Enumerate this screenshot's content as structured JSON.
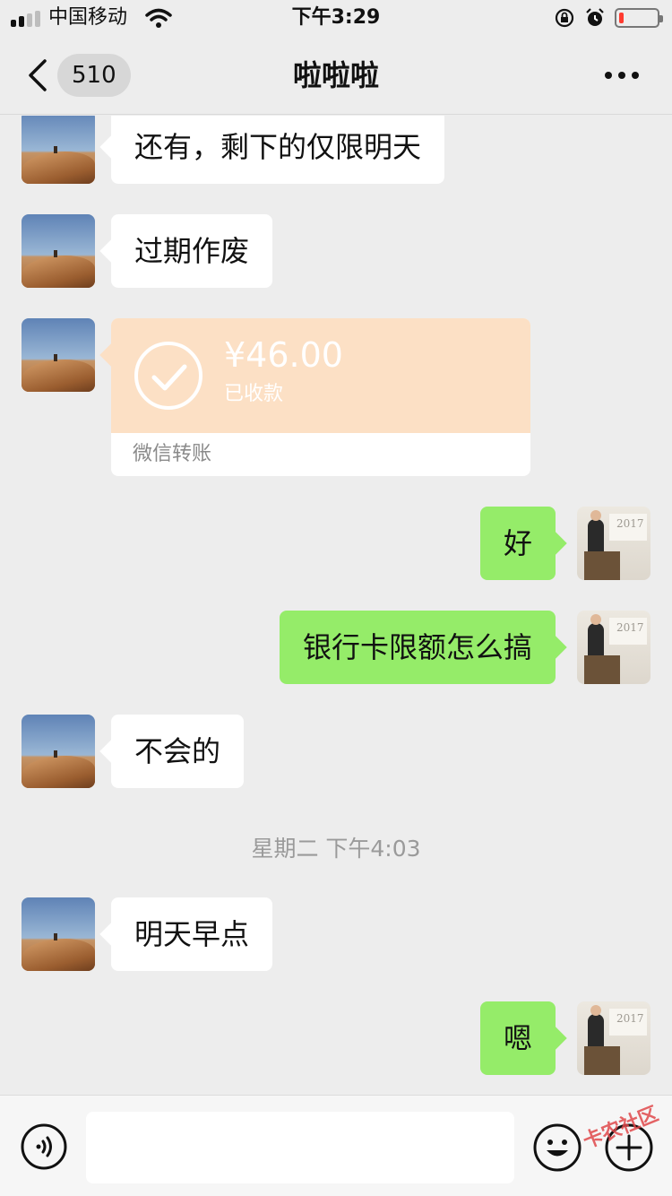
{
  "status_bar": {
    "carrier": "中国移动",
    "time": "下午3:29",
    "battery_level": 0.12,
    "icons": [
      "signal-icon",
      "wifi-icon",
      "rotation-lock-icon",
      "alarm-icon",
      "battery-icon"
    ]
  },
  "header": {
    "unread_count": "510",
    "title": "啦啦啦",
    "more_icon": "more-dots-icon",
    "back_icon": "chevron-left-icon"
  },
  "messages": [
    {
      "side": "left",
      "type": "text",
      "text": "还有，剩下的仅限明天"
    },
    {
      "side": "left",
      "type": "text",
      "text": "过期作废"
    },
    {
      "side": "left",
      "type": "transfer",
      "amount": "¥46.00",
      "status": "已收款",
      "label": "微信转账"
    },
    {
      "side": "right",
      "type": "text",
      "text": "好"
    },
    {
      "side": "right",
      "type": "text",
      "text": "银行卡限额怎么搞"
    },
    {
      "side": "left",
      "type": "text",
      "text": "不会的"
    },
    {
      "type": "timestamp",
      "text": "星期二 下午4:03"
    },
    {
      "side": "left",
      "type": "text",
      "text": "明天早点"
    },
    {
      "side": "right",
      "type": "text",
      "text": "嗯"
    }
  ],
  "right_avatar_text": "2017",
  "input_bar": {
    "voice_icon": "voice-icon",
    "emoji_icon": "emoji-icon",
    "plus_icon": "plus-icon",
    "watermark": "卡农社区"
  },
  "colors": {
    "background": "#ededed",
    "bubble_self": "#95ec69",
    "bubble_other": "#ffffff",
    "transfer_card": "#fce0c5"
  }
}
